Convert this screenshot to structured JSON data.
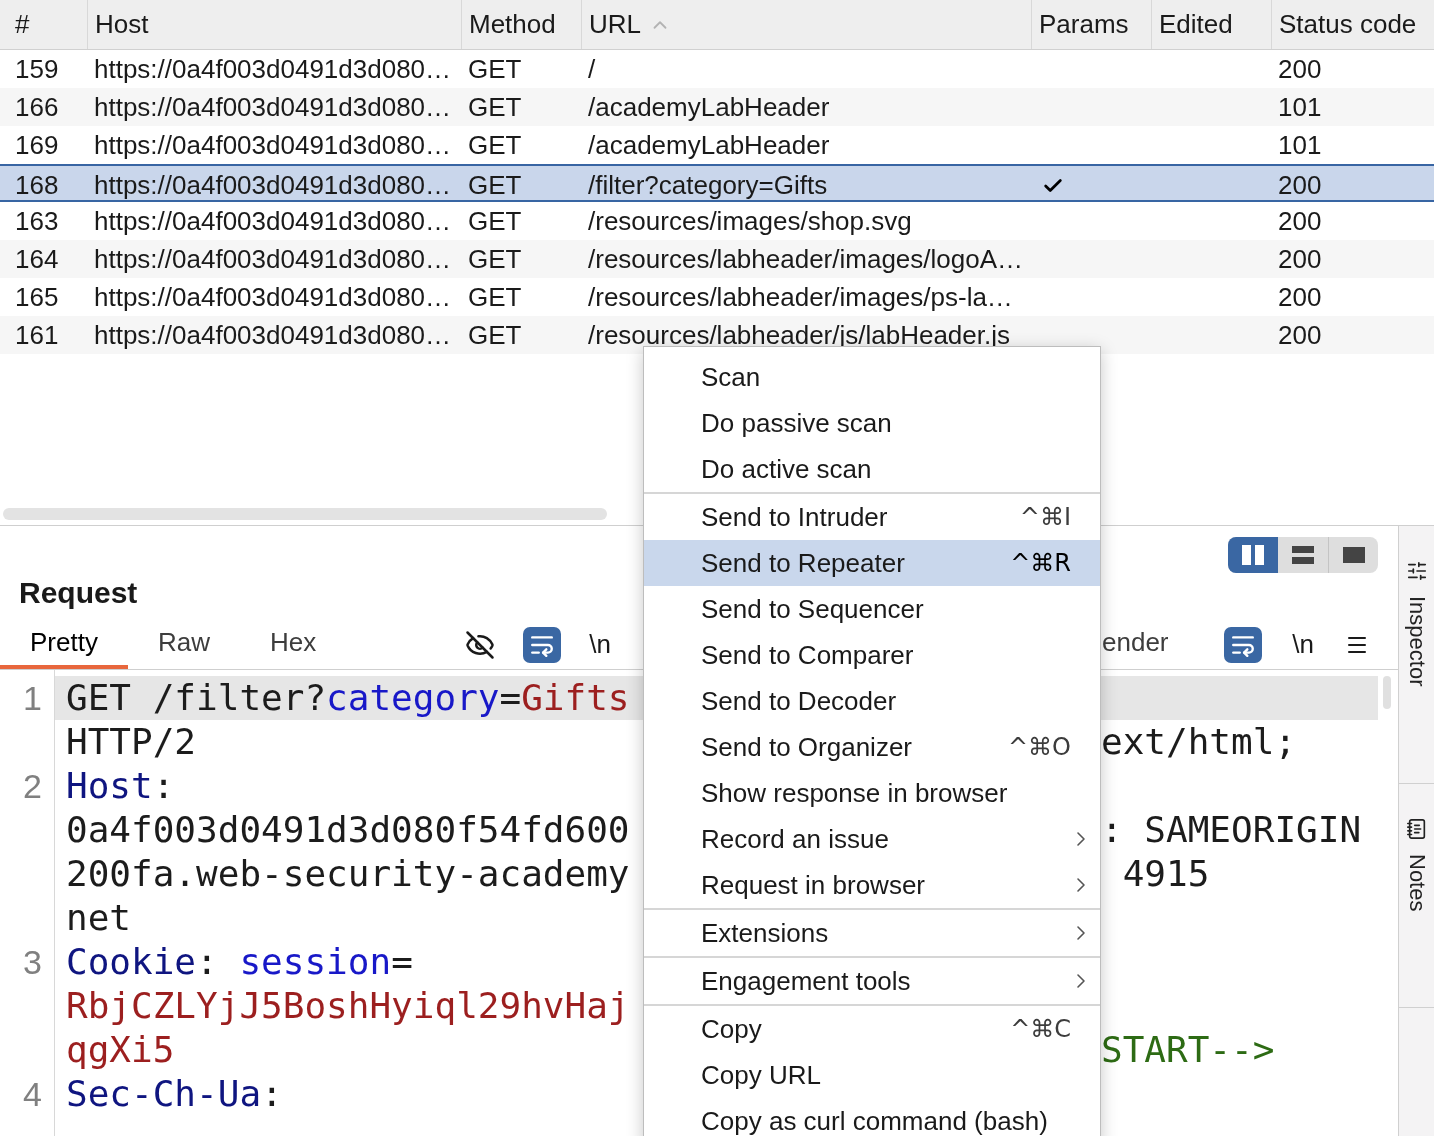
{
  "table": {
    "columns": [
      {
        "label": "#",
        "sorted": false
      },
      {
        "label": "Host",
        "sorted": false
      },
      {
        "label": "Method",
        "sorted": false
      },
      {
        "label": "URL",
        "sorted": true
      },
      {
        "label": "Params",
        "sorted": false
      },
      {
        "label": "Edited",
        "sorted": false
      },
      {
        "label": "Status code",
        "sorted": false
      }
    ],
    "rows": [
      {
        "number": "159",
        "host": "https://0a4f003d0491d3d080…",
        "method": "GET",
        "url": "/",
        "params": false,
        "status": "200",
        "selected": false
      },
      {
        "number": "166",
        "host": "https://0a4f003d0491d3d080…",
        "method": "GET",
        "url": "/academyLabHeader",
        "params": false,
        "status": "101",
        "selected": false
      },
      {
        "number": "169",
        "host": "https://0a4f003d0491d3d080…",
        "method": "GET",
        "url": "/academyLabHeader",
        "params": false,
        "status": "101",
        "selected": false
      },
      {
        "number": "168",
        "host": "https://0a4f003d0491d3d080…",
        "method": "GET",
        "url": "/filter?category=Gifts",
        "params": true,
        "status": "200",
        "selected": true
      },
      {
        "number": "163",
        "host": "https://0a4f003d0491d3d080…",
        "method": "GET",
        "url": "/resources/images/shop.svg",
        "params": false,
        "status": "200",
        "selected": false
      },
      {
        "number": "164",
        "host": "https://0a4f003d0491d3d080…",
        "method": "GET",
        "url": "/resources/labheader/images/logoA…",
        "params": false,
        "status": "200",
        "selected": false
      },
      {
        "number": "165",
        "host": "https://0a4f003d0491d3d080…",
        "method": "GET",
        "url": "/resources/labheader/images/ps-la…",
        "params": false,
        "status": "200",
        "selected": false
      },
      {
        "number": "161",
        "host": "https://0a4f003d0491d3d080…",
        "method": "GET",
        "url": "/resources/labheader/js/labHeader.js",
        "params": false,
        "status": "200",
        "selected": false
      }
    ]
  },
  "request": {
    "title": "Request",
    "tabs": [
      {
        "label": "Pretty",
        "selected": true
      },
      {
        "label": "Raw",
        "selected": false
      },
      {
        "label": "Hex",
        "selected": false
      }
    ],
    "toolbar": [
      {
        "kind": "hide",
        "on": false
      },
      {
        "kind": "wrap",
        "on": true
      },
      {
        "kind": "newline",
        "label": "\\n",
        "on": false
      }
    ],
    "lines": [
      {
        "number": "1",
        "highlighted": true,
        "rows": [
          [
            {
              "kind": "plain",
              "text": "GET /filter?"
            },
            {
              "kind": "param",
              "text": "category"
            },
            {
              "kind": "plain",
              "text": "="
            },
            {
              "kind": "value",
              "text": "Gifts"
            }
          ],
          [
            {
              "kind": "plain",
              "text": "HTTP/2"
            }
          ]
        ]
      },
      {
        "number": "2",
        "highlighted": false,
        "rows": [
          [
            {
              "kind": "header",
              "text": "Host"
            },
            {
              "kind": "plain",
              "text": ":"
            }
          ],
          [
            {
              "kind": "plain",
              "text": "0a4f003d0491d3d080f54fd600"
            }
          ],
          [
            {
              "kind": "plain",
              "text": "200fa.web-security-academy"
            }
          ],
          [
            {
              "kind": "plain",
              "text": "net"
            }
          ]
        ]
      },
      {
        "number": "3",
        "highlighted": false,
        "rows": [
          [
            {
              "kind": "header",
              "text": "Cookie"
            },
            {
              "kind": "plain",
              "text": ": "
            },
            {
              "kind": "param",
              "text": "session"
            },
            {
              "kind": "plain",
              "text": "="
            }
          ],
          [
            {
              "kind": "value",
              "text": "RbjCZLYjJ5BoshHyiql29hvHaj"
            }
          ],
          [
            {
              "kind": "value",
              "text": "qgXi5"
            }
          ]
        ]
      },
      {
        "number": "4",
        "highlighted": false,
        "rows": [
          [
            {
              "kind": "header",
              "text": "Sec-Ch-Ua"
            },
            {
              "kind": "plain",
              "text": ":"
            }
          ]
        ]
      }
    ]
  },
  "response": {
    "layout_toggle": [
      {
        "kind": "columns",
        "selected": true
      },
      {
        "kind": "rows",
        "selected": false
      },
      {
        "kind": "single",
        "selected": false
      }
    ],
    "tabs": [
      {
        "label": "ender",
        "selected": false
      }
    ],
    "toolbar": [
      {
        "kind": "wrap",
        "on": true
      },
      {
        "kind": "newline",
        "label": "\\n",
        "on": false
      },
      {
        "kind": "menu"
      }
    ],
    "rows": [
      {
        "highlighted": true
      },
      {
        "highlighted": false,
        "tokens": [
          {
            "kind": "plain",
            "text": "ext/html;"
          }
        ]
      },
      {
        "highlighted": false
      },
      {
        "highlighted": false,
        "tokens": [
          {
            "kind": "plain",
            "text": ": SAMEORIGIN"
          }
        ]
      },
      {
        "highlighted": false,
        "tokens": [
          {
            "kind": "plain",
            "text": " 4915"
          }
        ]
      },
      {
        "highlighted": false
      },
      {
        "highlighted": false
      },
      {
        "highlighted": false
      },
      {
        "highlighted": false,
        "tokens": [
          {
            "kind": "comment",
            "text": "START-->"
          }
        ]
      }
    ]
  },
  "sidebar": {
    "tabs": [
      {
        "kind": "inspector",
        "label": "Inspector",
        "selected": false
      },
      {
        "kind": "notes",
        "label": "Notes",
        "selected": false
      }
    ]
  },
  "context_menu": {
    "items": [
      {
        "kind": "item",
        "label": "Scan",
        "selected": false,
        "submenu": false
      },
      {
        "kind": "item",
        "label": "Do passive scan",
        "selected": false,
        "submenu": false
      },
      {
        "kind": "item",
        "label": "Do active scan",
        "selected": false,
        "submenu": false
      },
      {
        "kind": "separator"
      },
      {
        "kind": "item",
        "label": "Send to Intruder",
        "shortcut": "^⌘I",
        "selected": false,
        "submenu": false
      },
      {
        "kind": "item",
        "label": "Send to Repeater",
        "shortcut": "^⌘R",
        "selected": true,
        "submenu": false
      },
      {
        "kind": "item",
        "label": "Send to Sequencer",
        "selected": false,
        "submenu": false
      },
      {
        "kind": "item",
        "label": "Send to Comparer",
        "selected": false,
        "submenu": false
      },
      {
        "kind": "item",
        "label": "Send to Decoder",
        "selected": false,
        "submenu": false
      },
      {
        "kind": "item",
        "label": "Send to Organizer",
        "shortcut": "^⌘O",
        "selected": false,
        "submenu": false
      },
      {
        "kind": "item",
        "label": "Show response in browser",
        "selected": false,
        "submenu": false
      },
      {
        "kind": "item",
        "label": "Record an issue",
        "selected": false,
        "submenu": true
      },
      {
        "kind": "item",
        "label": "Request in browser",
        "selected": false,
        "submenu": true
      },
      {
        "kind": "separator"
      },
      {
        "kind": "item",
        "label": "Extensions",
        "selected": false,
        "submenu": true
      },
      {
        "kind": "separator"
      },
      {
        "kind": "item",
        "label": "Engagement tools",
        "selected": false,
        "submenu": true
      },
      {
        "kind": "separator"
      },
      {
        "kind": "item",
        "label": "Copy",
        "shortcut": "^⌘C",
        "selected": false,
        "submenu": false
      },
      {
        "kind": "item",
        "label": "Copy URL",
        "selected": false,
        "submenu": false
      },
      {
        "kind": "item",
        "label": "Copy as curl command (bash)",
        "selected": false,
        "submenu": false
      }
    ]
  }
}
